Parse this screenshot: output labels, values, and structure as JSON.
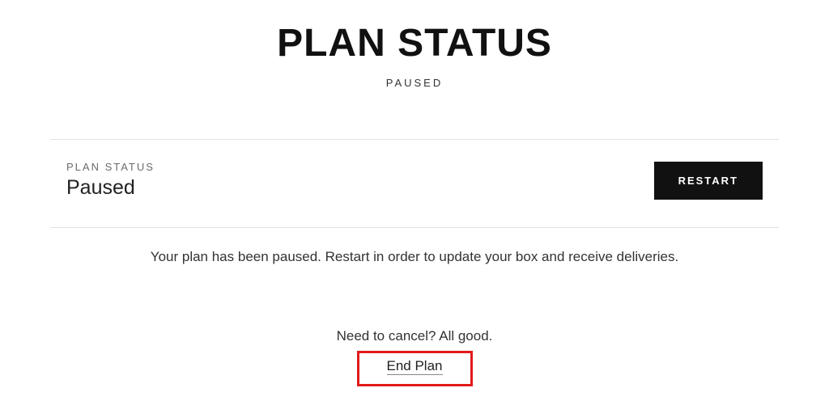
{
  "header": {
    "title": "PLAN STATUS",
    "subtitle": "PAUSED"
  },
  "status": {
    "label": "PLAN STATUS",
    "value": "Paused",
    "restart_button": "RESTART"
  },
  "message": "Your plan has been paused. Restart in order to update your box and receive deliveries.",
  "cancel": {
    "prompt": "Need to cancel? All good.",
    "link_text": "End Plan"
  }
}
